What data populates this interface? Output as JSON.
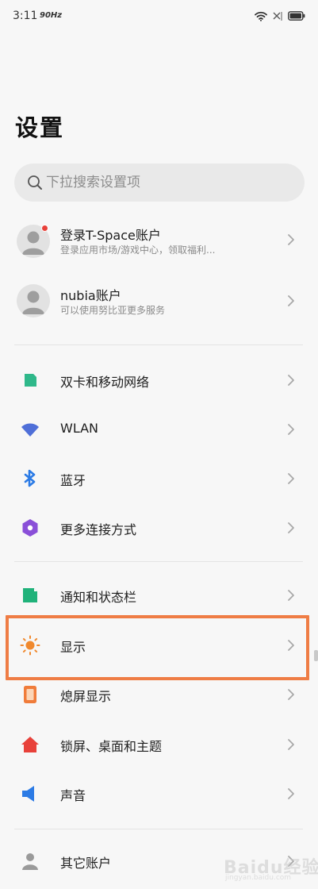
{
  "status_bar": {
    "time": "3:11",
    "refresh_rate": "90Hz"
  },
  "page_title": "设置",
  "search": {
    "placeholder": "下拉搜索设置项"
  },
  "accounts": [
    {
      "title": "登录T-Space账户",
      "subtitle": "登录应用市场/游戏中心，领取福利...",
      "has_notification": true
    },
    {
      "title": "nubia账户",
      "subtitle": "可以使用努比亚更多服务",
      "has_notification": false
    }
  ],
  "menu_items": [
    {
      "label": "双卡和移动网络",
      "icon": "sim-card-icon",
      "color": "#2fb88a"
    },
    {
      "label": "WLAN",
      "icon": "wifi-icon",
      "color": "#4f6fd8"
    },
    {
      "label": "蓝牙",
      "icon": "bluetooth-icon",
      "color": "#2c7be5"
    },
    {
      "label": "更多连接方式",
      "icon": "connection-icon",
      "color": "#8a4fd8"
    },
    {
      "label": "通知和状态栏",
      "icon": "notification-icon",
      "color": "#20b27a"
    },
    {
      "label": "显示",
      "icon": "sun-icon",
      "color": "#f0892e",
      "highlighted": true
    },
    {
      "label": "熄屏显示",
      "icon": "phone-screen-icon",
      "color": "#f07c3a"
    },
    {
      "label": "锁屏、桌面和主题",
      "icon": "home-icon",
      "color": "#e8413a"
    },
    {
      "label": "声音",
      "icon": "speaker-icon",
      "color": "#2c7be5"
    },
    {
      "label": "其它账户",
      "icon": "person-icon",
      "color": "#9a9a9a"
    }
  ],
  "colors": {
    "highlight": "#ef7d45",
    "background": "#f7f7f7",
    "search_bg": "#e9e9e9",
    "chevron": "#a8a8a8"
  },
  "watermark": {
    "main": "Baidu经验",
    "sub": "jingyan.baidu.com"
  }
}
